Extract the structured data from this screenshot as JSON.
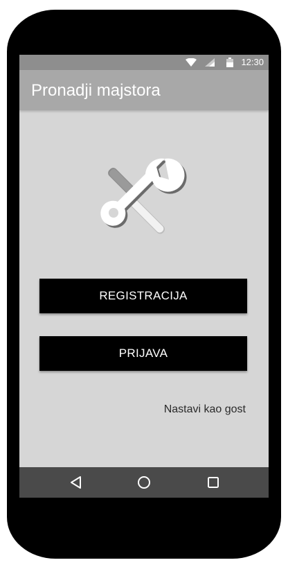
{
  "status_bar": {
    "time": "12:30",
    "icons": [
      "wifi-icon",
      "cell-signal-icon",
      "battery-icon"
    ]
  },
  "app_bar": {
    "title": "Pronadji majstora"
  },
  "logo": {
    "icon": "tools-icon"
  },
  "actions": {
    "register_label": "REGISTRACIJA",
    "login_label": "PRIJAVA",
    "guest_label": "Nastavi kao gost"
  },
  "nav_bar": {
    "icons": [
      "back-icon",
      "home-icon",
      "recents-icon"
    ]
  },
  "colors": {
    "screen_bg": "#d6d6d6",
    "app_bar": "#a8a8a8",
    "status_bar": "#8e8e8e",
    "button_bg": "#000000",
    "nav_bar": "#4a4a4a"
  }
}
